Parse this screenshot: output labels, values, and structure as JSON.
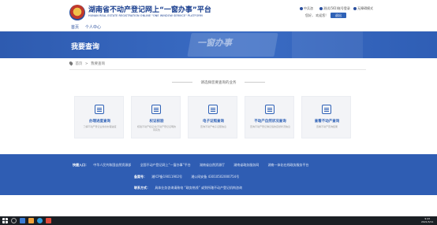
{
  "header": {
    "title": "湖南省不动产登记网上“一窗办事”平台",
    "subtitle": "HUNAN REAL ESTATE REGISTRATION ONLINE \"ONE WINDOW SERVICE\" PLATFORM",
    "links": [
      "中兵咨",
      "测试(5ID)账号登录",
      "无障碍模式"
    ],
    "login_text": "您好， 欢迎您!",
    "logout_label": "退出"
  },
  "nav": {
    "items": [
      "首页",
      "个人中心"
    ]
  },
  "banner": {
    "title": "我要查询",
    "deco_text": "一窗办事"
  },
  "breadcrumb": {
    "items": [
      "首页",
      "我要查询"
    ],
    "separator": ">"
  },
  "section": {
    "title": "请选择您要查询的业务"
  },
  "cards": [
    {
      "title": "办理进度查询",
      "desc": "了解不动产登记业务的办理进度"
    },
    {
      "title": "权证核验",
      "desc": "核验不动产权证书/不动产登记证明的真实性"
    },
    {
      "title": "电子证照查询",
      "desc": "查询不动产电子证照信息"
    },
    {
      "title": "不动产自然状况查询",
      "desc": "查询不动产登记簿记载的自然状况信息"
    },
    {
      "title": "查看不动产查询",
      "desc": "查看不动产查询结果"
    }
  ],
  "footer": {
    "links_label": "快捷入口：",
    "links": [
      "中华人民共和国自然资源部",
      "全国不动产登记网上“一窗办事”平台",
      "湖南省自然资源厅",
      "湖南省政务服务网",
      "湖南一体化在线政务服务平台"
    ],
    "host_label": "备案号：",
    "host_items": [
      "湘ICP备19011902号",
      "湘公网安备 43010502000754号"
    ],
    "contact_label": "联系方式：",
    "contact_text": "具体业务咨询请致电 “政务热线” 或到所辖不动产登记机构咨询"
  },
  "taskbar": {
    "time": "9:43",
    "date": "2021/3/11"
  },
  "colors": {
    "primary": "#2f62b7",
    "banner": "#2e5bb0",
    "footer": "#2f5db3"
  }
}
